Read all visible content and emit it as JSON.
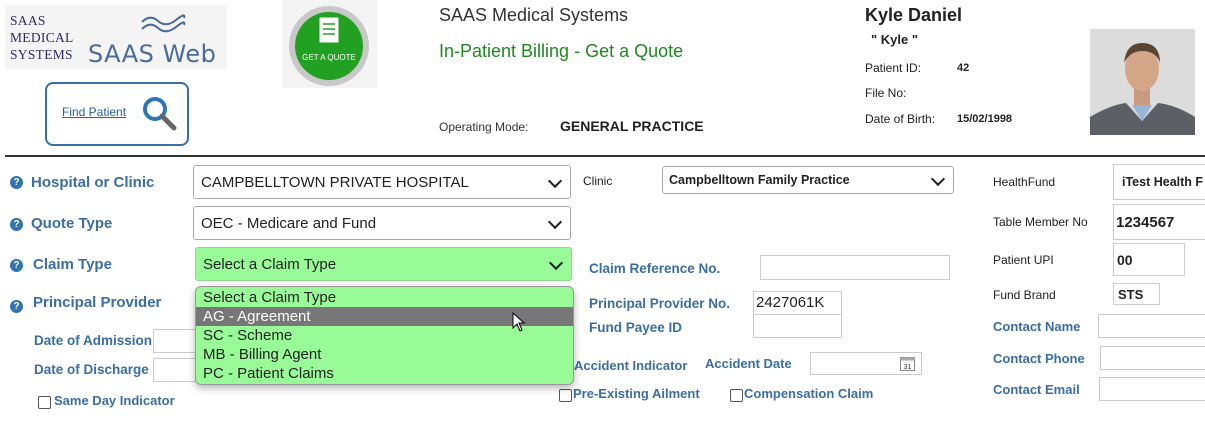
{
  "header": {
    "logo_small_lines": [
      "SAAS",
      "MEDICAL",
      "SYSTEMS"
    ],
    "logo_web": "SAAS Web",
    "find_patient": "Find Patient",
    "quote_logo_text": "GET A QUOTE",
    "app_title": "SAAS Medical Systems",
    "page_title": "In-Patient Billing - Get a Quote",
    "operating_mode_label": "Operating Mode:",
    "operating_mode_value": "GENERAL PRACTICE"
  },
  "patient": {
    "name": "Kyle Daniel",
    "nickname": "\" Kyle \"",
    "id_label": "Patient ID:",
    "id_value": "42",
    "file_label": "File No:",
    "file_value": "",
    "dob_label": "Date of Birth:",
    "dob_value": "15/02/1998"
  },
  "form": {
    "hospital_label": "Hospital or Clinic",
    "hospital_value": "CAMPBELLTOWN PRIVATE HOSPITAL",
    "clinic_label": "Clinic",
    "clinic_value": "Campbelltown Family Practice",
    "quote_type_label": "Quote Type",
    "quote_type_value": "OEC - Medicare and Fund",
    "claim_type_label": "Claim Type",
    "claim_type_value": "Select a Claim Type",
    "claim_type_options": [
      "Select a Claim Type",
      "AG - Agreement",
      "SC - Scheme",
      "MB - Billing Agent",
      "PC - Patient Claims"
    ],
    "claim_type_highlighted": "AG - Agreement",
    "principal_provider_label": "Principal Provider",
    "date_admission_label": "Date of Admission",
    "date_discharge_label": "Date of Discharge",
    "same_day_label": "Same Day Indicator",
    "claim_ref_label": "Claim Reference No.",
    "claim_ref_value": "",
    "principal_provider_no_label": "Principal Provider No.",
    "principal_provider_no_value": "2427061K",
    "fund_payee_label": "Fund Payee ID",
    "fund_payee_value": "",
    "accident_indicator_label": "Accident Indicator",
    "accident_date_label": "Accident Date",
    "accident_date_value": "",
    "calendar_day": "31",
    "pre_existing_label": "Pre-Existing Ailment",
    "compensation_label": "Compensation Claim"
  },
  "fund": {
    "healthfund_label": "HealthFund",
    "healthfund_value": "iTest Health F",
    "table_member_label": "Table Member No",
    "table_member_value": "1234567",
    "patient_upi_label": "Patient UPI",
    "patient_upi_value": "00",
    "fund_brand_label": "Fund Brand",
    "fund_brand_value": "STS",
    "contact_name_label": "Contact Name",
    "contact_phone_label": "Contact Phone",
    "contact_email_label": "Contact Email"
  },
  "colors": {
    "label_blue": "#3a6ea5",
    "title_green": "#1f8a1f",
    "dropdown_green": "#98fb98",
    "highlight_grey": "#777777"
  }
}
